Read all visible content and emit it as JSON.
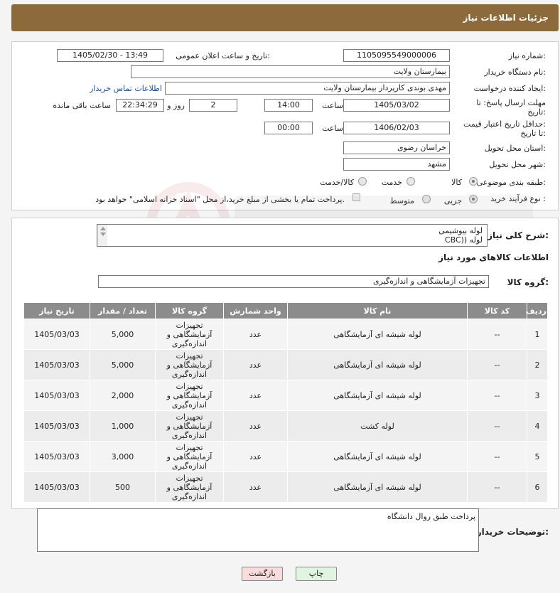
{
  "header": {
    "title": "جزئیات اطلاعات نیاز"
  },
  "form": {
    "need_number_label": "شماره نیاز:",
    "need_number": "1105095549000006",
    "announce_label": "تاریخ و ساعت اعلان عمومی:",
    "announce_value": "1405/02/30 - 13:49",
    "buyer_org_label": "نام دستگاه خریدار:",
    "buyer_org": "بیمارستان ولایت",
    "creator_label": "ایجاد کننده درخواست:",
    "creator": "مهدی بوندی کارپرداز بیمارستان ولایت",
    "contact_link": "اطلاعات تماس خریدار",
    "deadline_label_1": "مهلت ارسال پاسخ: تا",
    "deadline_label_2": "تاریخ:",
    "deadline_date": "1405/03/02",
    "time_label": "ساعت",
    "deadline_time": "14:00",
    "days_value": "2",
    "days_label": "روز و",
    "remaining_value": "22:34:29",
    "remaining_label": "ساعت باقی مانده",
    "min_valid_label_1": "حداقل تاریخ اعتبار قیمت:",
    "min_valid_label_2": "تا تاریخ:",
    "min_valid_date": "1406/02/03",
    "min_valid_time": "00:00",
    "province_label": "استان محل تحویل:",
    "province": "خراسان رضوی",
    "city_label": "شهر محل تحویل:",
    "city": "مشهد",
    "category_label": "طبقه بندی موضوعی:",
    "category_options": [
      "کالا",
      "خدمت",
      "کالا/خدمت"
    ],
    "process_label": "نوع فرآیند خرید :",
    "process_options": [
      "جزیی",
      "متوسط"
    ],
    "payment_note": "پرداخت تمام یا بخشی از مبلغ خرید،از محل \"اسناد خزانه اسلامی\" خواهد بود."
  },
  "summary": {
    "label": "شرح کلی نیاز:",
    "lines": [
      "لوله بیوشیمی",
      "لوله ((CBC"
    ]
  },
  "goods": {
    "section_title": "اطلاعات کالاهای مورد نیاز",
    "group_label": "گروه کالا:",
    "group_value": "تجهیزات آزمایشگاهی و اندازه‌گیری"
  },
  "table": {
    "headers": [
      "ردیف",
      "کد کالا",
      "نام کالا",
      "واحد شمارش",
      "گروه کالا",
      "تعداد / مقدار",
      "تاریخ نیاز"
    ],
    "rows": [
      [
        "1",
        "--",
        "لوله شیشه ای آزمایشگاهی",
        "عدد",
        "تجهیزات آزمایشگاهی و اندازه‌گیری",
        "5,000",
        "1405/03/03"
      ],
      [
        "2",
        "--",
        "لوله شیشه ای آزمایشگاهی",
        "عدد",
        "تجهیزات آزمایشگاهی و اندازه‌گیری",
        "5,000",
        "1405/03/03"
      ],
      [
        "3",
        "--",
        "لوله شیشه ای آزمایشگاهی",
        "عدد",
        "تجهیزات آزمایشگاهی و اندازه‌گیری",
        "2,000",
        "1405/03/03"
      ],
      [
        "4",
        "--",
        "لوله کشت",
        "عدد",
        "تجهیزات آزمایشگاهی و اندازه‌گیری",
        "1,000",
        "1405/03/03"
      ],
      [
        "5",
        "--",
        "لوله شیشه ای آزمایشگاهی",
        "عدد",
        "تجهیزات آزمایشگاهی و اندازه‌گیری",
        "3,000",
        "1405/03/03"
      ],
      [
        "6",
        "--",
        "لوله شیشه ای آزمایشگاهی",
        "عدد",
        "تجهیزات آزمایشگاهی و اندازه‌گیری",
        "500",
        "1405/03/03"
      ]
    ]
  },
  "buyer_notes": {
    "label": "توضیحات خریدار:",
    "value": "پرداخت طبق روال دانشگاه"
  },
  "buttons": {
    "print": "چاپ",
    "back": "بازگشت"
  },
  "colors": {
    "header_bg": "#8d6a3c",
    "table_header_bg": "#8c8c8c",
    "link": "#1a4f9c"
  }
}
